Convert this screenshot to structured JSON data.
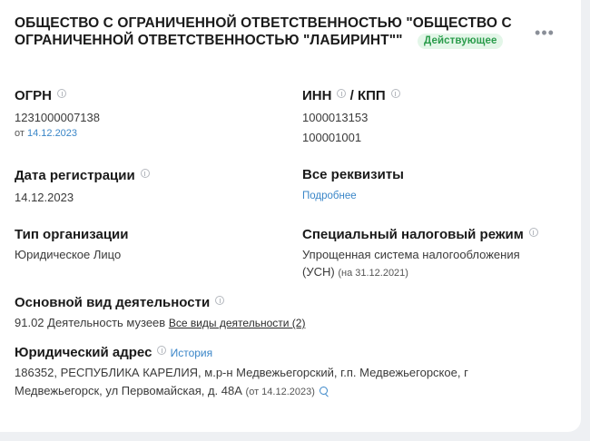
{
  "company": {
    "name": "ОБЩЕСТВО С ОГРАНИЧЕННОЙ ОТВЕТСТВЕННОСТЬЮ \"ОБЩЕСТВО С ОГРАНИЧЕННОЙ ОТВЕТСТВЕННОСТЬЮ \"ЛАБИРИНТ\"\"",
    "status": "Действующее"
  },
  "more_menu_icon": "more-horizontal-icon",
  "ogrn": {
    "label": "ОГРН",
    "value": "1231000007138",
    "date_prefix": "от",
    "date": "14.12.2023"
  },
  "inn_kpp": {
    "label_inn": "ИНН",
    "label_sep": "/ КПП",
    "inn": "1000013153",
    "kpp": "100001001"
  },
  "registration": {
    "label": "Дата регистрации",
    "value": "14.12.2023"
  },
  "requisites": {
    "label": "Все реквизиты",
    "link": "Подробнее"
  },
  "org_type": {
    "label": "Тип организации",
    "value": "Юридическое Лицо"
  },
  "tax_regime": {
    "label": "Специальный налоговый режим",
    "value_line1": "Упрощенная система налогообложения",
    "value_line2": "(УСН)",
    "date": "(на 31.12.2021)"
  },
  "activity": {
    "label": "Основной вид деятельности",
    "value": "91.02 Деятельность музеев",
    "all_link": "Все виды деятельности (2)"
  },
  "address": {
    "label": "Юридический адрес",
    "history_link": "История",
    "line1": "186352, РЕСПУБЛИКА КАРЕЛИЯ, м.р-н Медвежьегорский, г.п. Медвежьегорское, г",
    "line2": "Медвежьегорск, ул Первомайская, д. 48А",
    "date": "(от 14.12.2023)"
  }
}
